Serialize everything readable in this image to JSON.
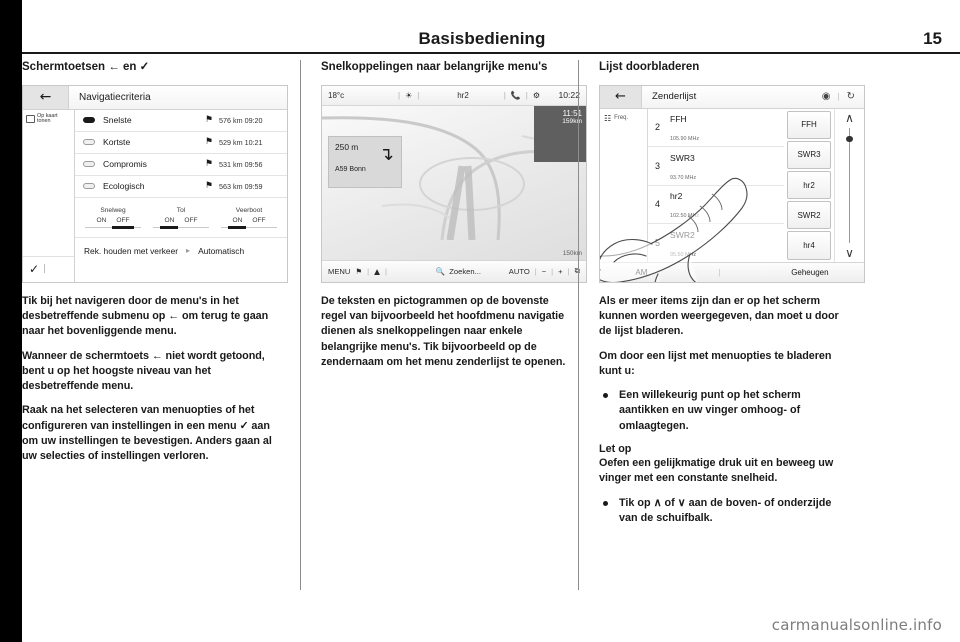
{
  "header": {
    "title": "Basisbediening",
    "page_number": "15"
  },
  "columns": [
    {
      "heading": "Schermtoetsen ← en ✓",
      "paragraphs": [
        "Tik bij het navigeren door de menu's in het desbetreffende submenu op ← om terug te gaan naar het bovenliggende menu.",
        "Wanneer de schermtoets ← niet wordt getoond, bent u op het hoogste niveau van het desbetreffende menu.",
        "Raak na het selecteren van menuopties of het configureren van instellingen in een menu ✓ aan om uw instellingen te bevestigen. Anders gaan al uw selecties of instellingen verloren."
      ]
    },
    {
      "heading": "Snelkoppelingen naar belangrijke menu's",
      "paragraphs": [
        "De teksten en pictogrammen op de bovenste regel van bijvoorbeeld het hoofdmenu navigatie dienen als snelkoppelingen naar enkele belangrijke menu's. Tik bijvoorbeeld op de zendernaam om het menu zenderlijst te openen."
      ]
    },
    {
      "heading": "Lijst doorbladeren",
      "paragraphs": [
        "Als er meer items zijn dan er op het scherm kunnen worden weergegeven, dan moet u door de lijst bladeren.",
        "Om door een lijst met menuopties te bladeren kunt u:"
      ],
      "bullets_1": [
        "Een willekeurig punt op het scherm aantikken en uw vinger omhoog- of omlaagtegen."
      ],
      "note_title": "Let op",
      "note_text": "Oefen een gelijkmatige druk uit en beweeg uw vinger met een constante snelheid.",
      "bullets_2": [
        "Tik op ∧ of ∨ aan de boven- of onderzijde van de schuifbalk."
      ]
    }
  ],
  "nav_criteria_screen": {
    "back_icon": "back-arrow-icon",
    "title": "Navigatiecriteria",
    "side_button_label": "Op kaart tonen",
    "confirm_icon": "check-icon",
    "rows": [
      {
        "label": "Snelste",
        "selected": true,
        "flag": "⚑",
        "distance": "576 km 09:20"
      },
      {
        "label": "Kortste",
        "selected": false,
        "flag": "⚑",
        "distance": "529 km 10:21"
      },
      {
        "label": "Compromis",
        "selected": false,
        "flag": "⚑",
        "distance": "531 km 09:56"
      },
      {
        "label": "Ecologisch",
        "selected": false,
        "flag": "⚑",
        "distance": "563 km 09:59"
      }
    ],
    "toggles": [
      {
        "name": "Snelweg",
        "on_label": "ON",
        "off_label": "OFF",
        "active": "OFF"
      },
      {
        "name": "Tol",
        "on_label": "ON",
        "off_label": "OFF",
        "active": "ON"
      },
      {
        "name": "Veerboot",
        "on_label": "ON",
        "off_label": "OFF",
        "active": "ON"
      }
    ],
    "footer_label": "Rek. houden met verkeer",
    "footer_value": "Automatisch"
  },
  "map_screen": {
    "temperature": "18°c",
    "status_icon_left": "sun-icon",
    "station": "hr2",
    "status_icon_right_1": "phone-icon",
    "status_icon_right_2": "gear-icon",
    "time": "10:22",
    "guide_distance": "250 m",
    "guide_street": "A59 Bonn",
    "guide_arrow": "turn-right-icon",
    "eta_time": "11:51",
    "eta_distance": "159km",
    "scale_label": "150km",
    "menu_label": "MENU",
    "menu_flag_icon": "flag-icon",
    "menu_position_icon": "position-arrow-icon",
    "search_icon": "search-icon",
    "search_label": "Zoeken...",
    "auto_label": "AUTO",
    "zoom_out": "−",
    "zoom_in": "+",
    "expand_icon": "expand-icon"
  },
  "station_list_screen": {
    "back_icon": "back-arrow-icon",
    "title": "Zenderlijst",
    "icon_tune": "tune-icon",
    "icon_refresh": "refresh-icon",
    "side_icon": "freq-icon",
    "side_label": "Freq.",
    "stations": [
      {
        "number": "2",
        "name": "FFH",
        "freq": "105.90 MHz"
      },
      {
        "number": "3",
        "name": "SWR3",
        "freq": "93.70 MHz"
      },
      {
        "number": "4",
        "name": "hr2",
        "freq": "102.50 MHz"
      },
      {
        "number": "5",
        "name": "SWR2",
        "freq": "95.50 MHz"
      }
    ],
    "presets": [
      "FFH",
      "SWR3",
      "hr2",
      "SWR2",
      "hr4"
    ],
    "scroll_up_icon": "chevron-up-icon",
    "scroll_down_icon": "chevron-down-icon",
    "bottom_left": "AM",
    "bottom_right": "Geheugen"
  },
  "watermark": "carmanualsonline.info"
}
